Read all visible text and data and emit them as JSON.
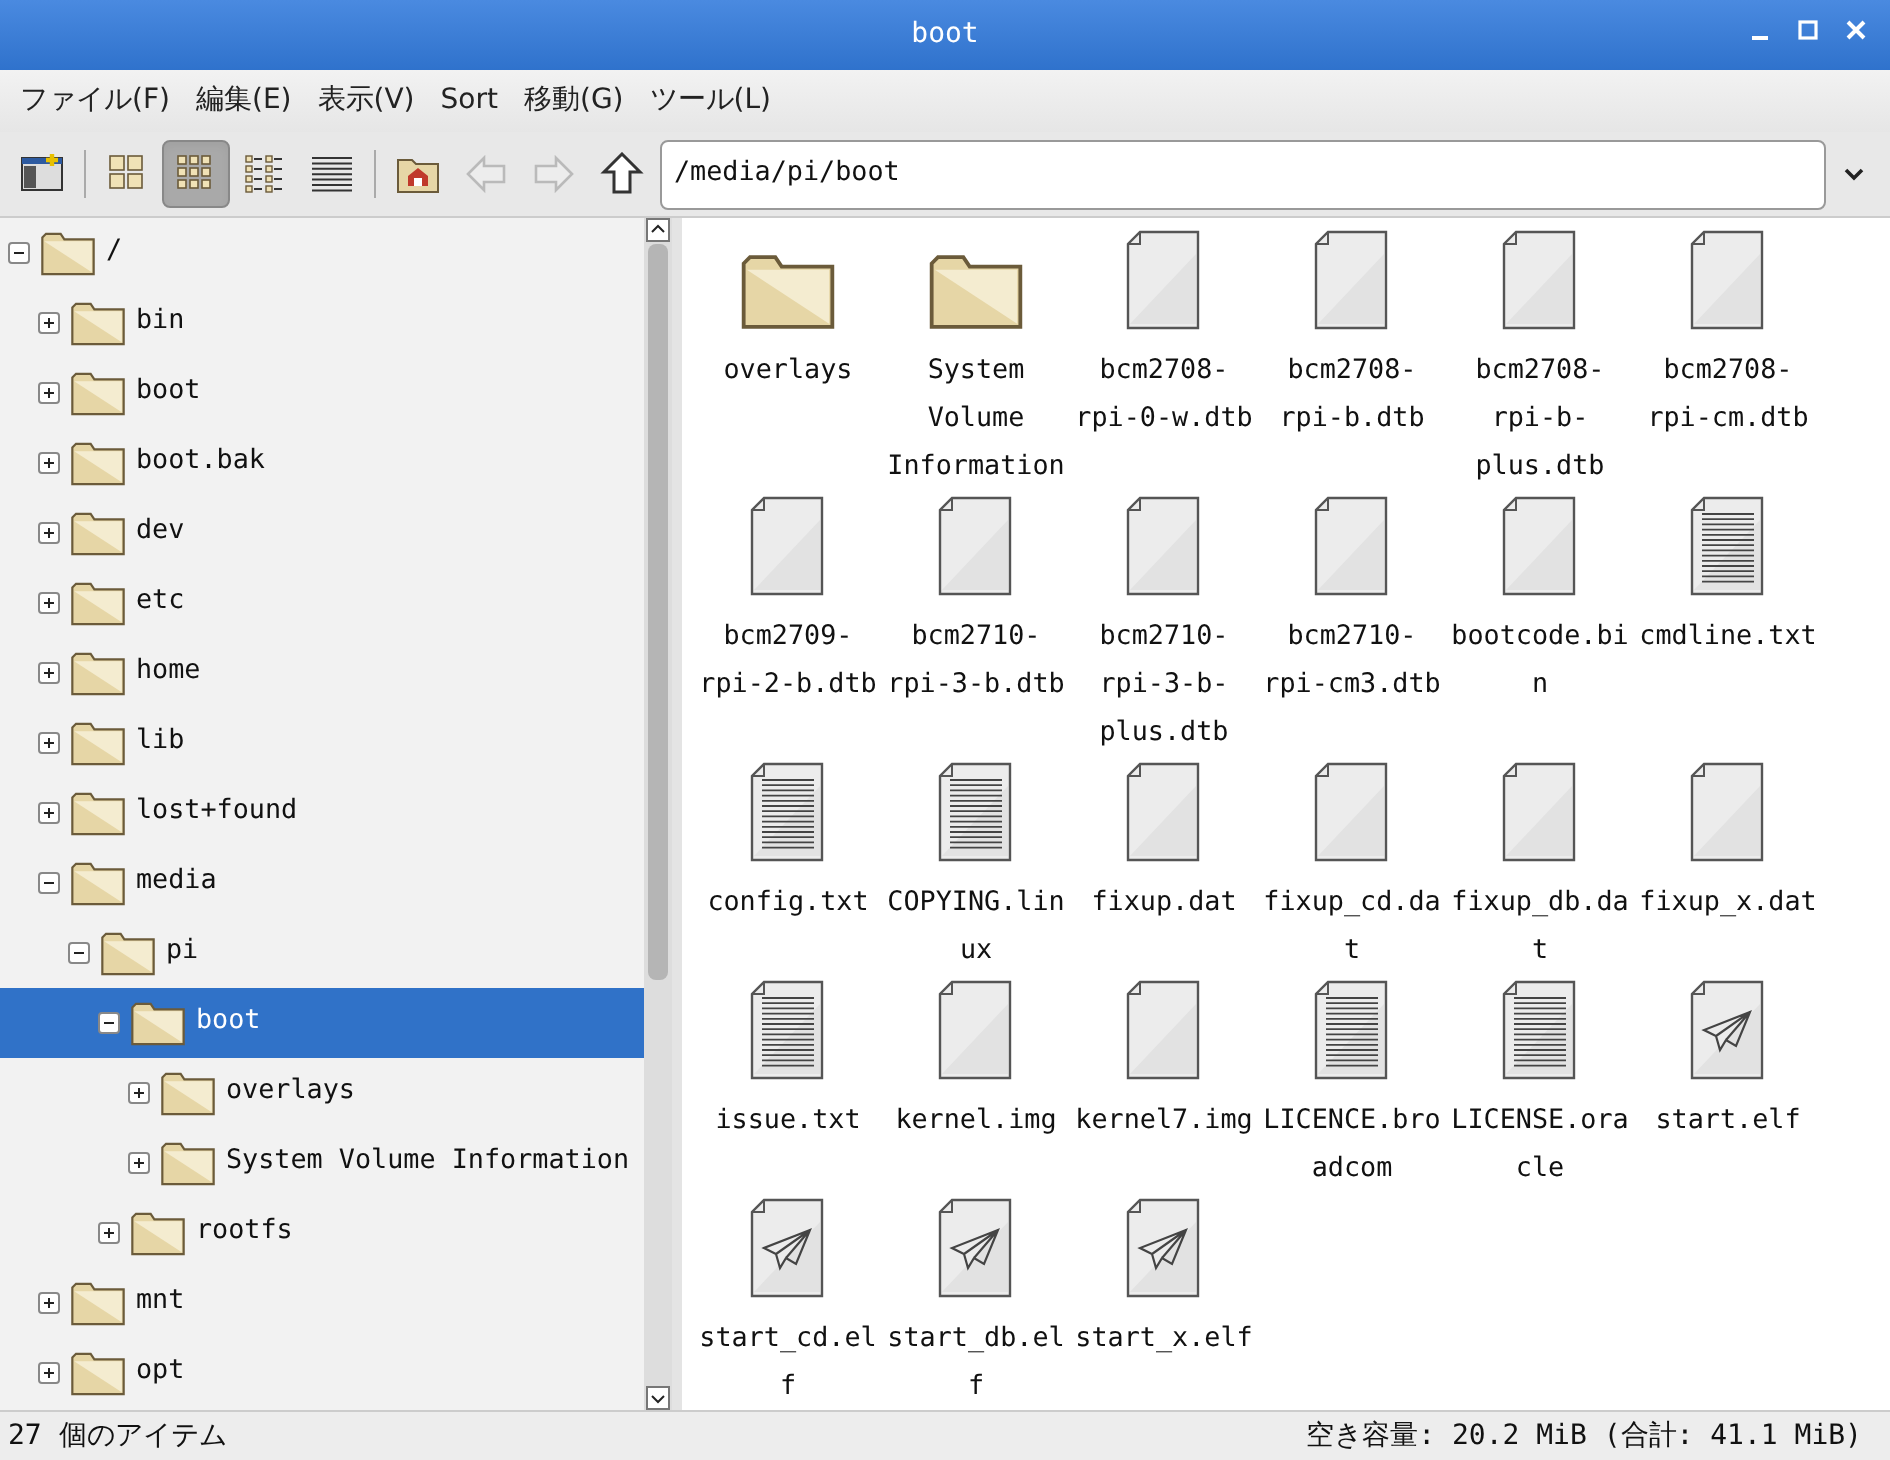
{
  "window": {
    "title": "boot"
  },
  "menu": [
    "ファイル(F)",
    "編集(E)",
    "表示(V)",
    "Sort",
    "移動(G)",
    "ツール(L)"
  ],
  "toolbar": {
    "buttons": [
      {
        "kind": "new-window",
        "selected": false,
        "disabled": false
      },
      {
        "kind": "thumbnails",
        "selected": false,
        "disabled": false
      },
      {
        "kind": "icons",
        "selected": true,
        "disabled": false
      },
      {
        "kind": "compact",
        "selected": false,
        "disabled": false
      },
      {
        "kind": "list",
        "selected": false,
        "disabled": false
      },
      {
        "kind": "home",
        "selected": false,
        "disabled": false
      },
      {
        "kind": "back",
        "selected": false,
        "disabled": true
      },
      {
        "kind": "forward",
        "selected": false,
        "disabled": true
      },
      {
        "kind": "up",
        "selected": false,
        "disabled": false
      }
    ],
    "path": "/media/pi/boot"
  },
  "tree": [
    {
      "label": "/",
      "expanded": true,
      "selected": false,
      "children": [
        {
          "label": "bin",
          "expanded": false,
          "selected": false
        },
        {
          "label": "boot",
          "expanded": false,
          "selected": false
        },
        {
          "label": "boot.bak",
          "expanded": false,
          "selected": false
        },
        {
          "label": "dev",
          "expanded": false,
          "selected": false
        },
        {
          "label": "etc",
          "expanded": false,
          "selected": false
        },
        {
          "label": "home",
          "expanded": false,
          "selected": false
        },
        {
          "label": "lib",
          "expanded": false,
          "selected": false
        },
        {
          "label": "lost+found",
          "expanded": false,
          "selected": false
        },
        {
          "label": "media",
          "expanded": true,
          "selected": false,
          "children": [
            {
              "label": "pi",
              "expanded": true,
              "selected": false,
              "children": [
                {
                  "label": "boot",
                  "expanded": true,
                  "selected": true,
                  "children": [
                    {
                      "label": "overlays",
                      "expanded": false,
                      "selected": false
                    },
                    {
                      "label": "System Volume Information",
                      "expanded": false,
                      "selected": false
                    }
                  ]
                },
                {
                  "label": "rootfs",
                  "expanded": false,
                  "selected": false
                }
              ]
            }
          ]
        },
        {
          "label": "mnt",
          "expanded": false,
          "selected": false
        },
        {
          "label": "opt",
          "expanded": false,
          "selected": false
        }
      ]
    }
  ],
  "files": [
    {
      "name": "overlays",
      "kind": "folder"
    },
    {
      "name": "System Volume Information",
      "kind": "folder"
    },
    {
      "name": "bcm2708-rpi-0-w.dtb",
      "kind": "file"
    },
    {
      "name": "bcm2708-rpi-b.dtb",
      "kind": "file"
    },
    {
      "name": "bcm2708-rpi-b-plus.dtb",
      "kind": "file"
    },
    {
      "name": "bcm2708-rpi-cm.dtb",
      "kind": "file"
    },
    {
      "name": "bcm2709-rpi-2-b.dtb",
      "kind": "file"
    },
    {
      "name": "bcm2710-rpi-3-b.dtb",
      "kind": "file"
    },
    {
      "name": "bcm2710-rpi-3-b-plus.dtb",
      "kind": "file"
    },
    {
      "name": "bcm2710-rpi-cm3.dtb",
      "kind": "file"
    },
    {
      "name": "bootcode.bin",
      "kind": "file"
    },
    {
      "name": "cmdline.txt",
      "kind": "text"
    },
    {
      "name": "config.txt",
      "kind": "text"
    },
    {
      "name": "COPYING.linux",
      "kind": "text"
    },
    {
      "name": "fixup.dat",
      "kind": "file"
    },
    {
      "name": "fixup_cd.dat",
      "kind": "file"
    },
    {
      "name": "fixup_db.dat",
      "kind": "file"
    },
    {
      "name": "fixup_x.dat",
      "kind": "file"
    },
    {
      "name": "issue.txt",
      "kind": "text"
    },
    {
      "name": "kernel.img",
      "kind": "file"
    },
    {
      "name": "kernel7.img",
      "kind": "file"
    },
    {
      "name": "LICENCE.broadcom",
      "kind": "text"
    },
    {
      "name": "LICENSE.oracle",
      "kind": "text"
    },
    {
      "name": "start.elf",
      "kind": "elf"
    },
    {
      "name": "start_cd.elf",
      "kind": "elf"
    },
    {
      "name": "start_db.elf",
      "kind": "elf"
    },
    {
      "name": "start_x.elf",
      "kind": "elf"
    }
  ],
  "status_bar": {
    "count": "27 個のアイテム",
    "space": "空き容量: 20.2 MiB (合計: 41.1 MiB)"
  }
}
